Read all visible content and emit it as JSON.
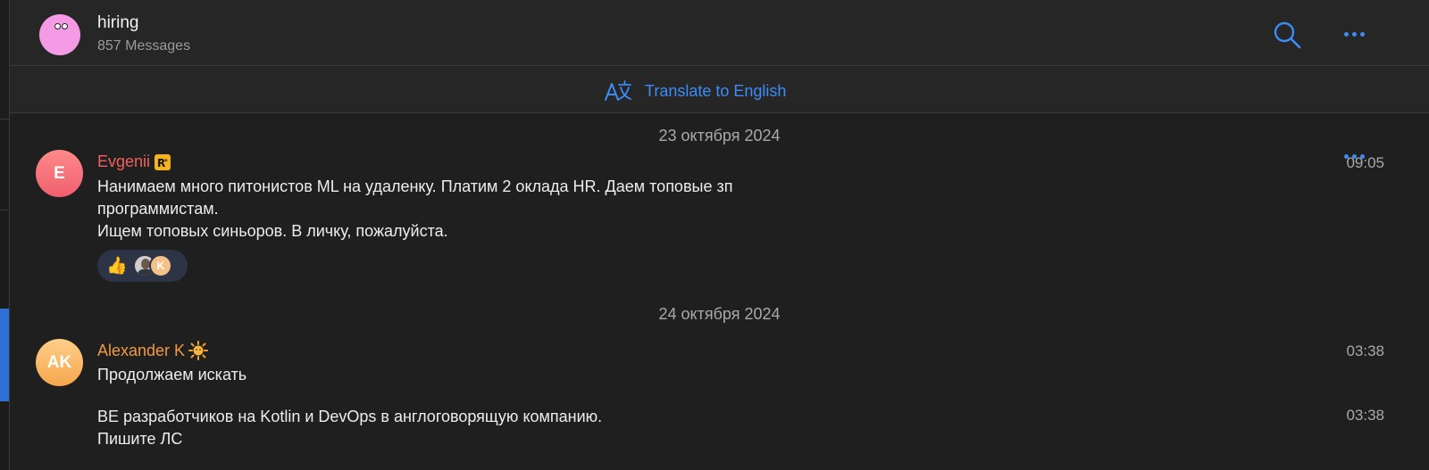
{
  "header": {
    "title": "hiring",
    "subtitle": "857 Messages",
    "avatar_color": "#f59be6"
  },
  "translate_bar": {
    "label": "Translate to English"
  },
  "colors": {
    "accent": "#3b8df5",
    "sender_red": "#f0605e",
    "sender_orange": "#f29a3e"
  },
  "messages": [
    {
      "date": "23 октября 2024",
      "sender": "Evgenii",
      "badge_icon": "rockstar-emoji-icon",
      "avatar_initials": "E",
      "time": "09:05",
      "lines": [
        "Нанимаем много питонистов ML на удаленку. Платим 2 оклада HR. Даем топовые зп",
        "программистам.",
        "Ищем топовых синьоров. В личку, пожалуйста."
      ],
      "reaction": {
        "emoji": "👍",
        "reactor_initial": "K"
      }
    },
    {
      "date": "24 октября 2024",
      "sender": "Alexander K",
      "badge_icon": "sun-emoji-icon",
      "avatar_initials": "AK",
      "time": "03:38",
      "lines": [
        "Продолжаем искать"
      ]
    },
    {
      "time": "03:38",
      "lines": [
        "BE разработчиков на Kotlin и DevOps в англоговорящую компанию.",
        "Пишите ЛС"
      ]
    }
  ]
}
